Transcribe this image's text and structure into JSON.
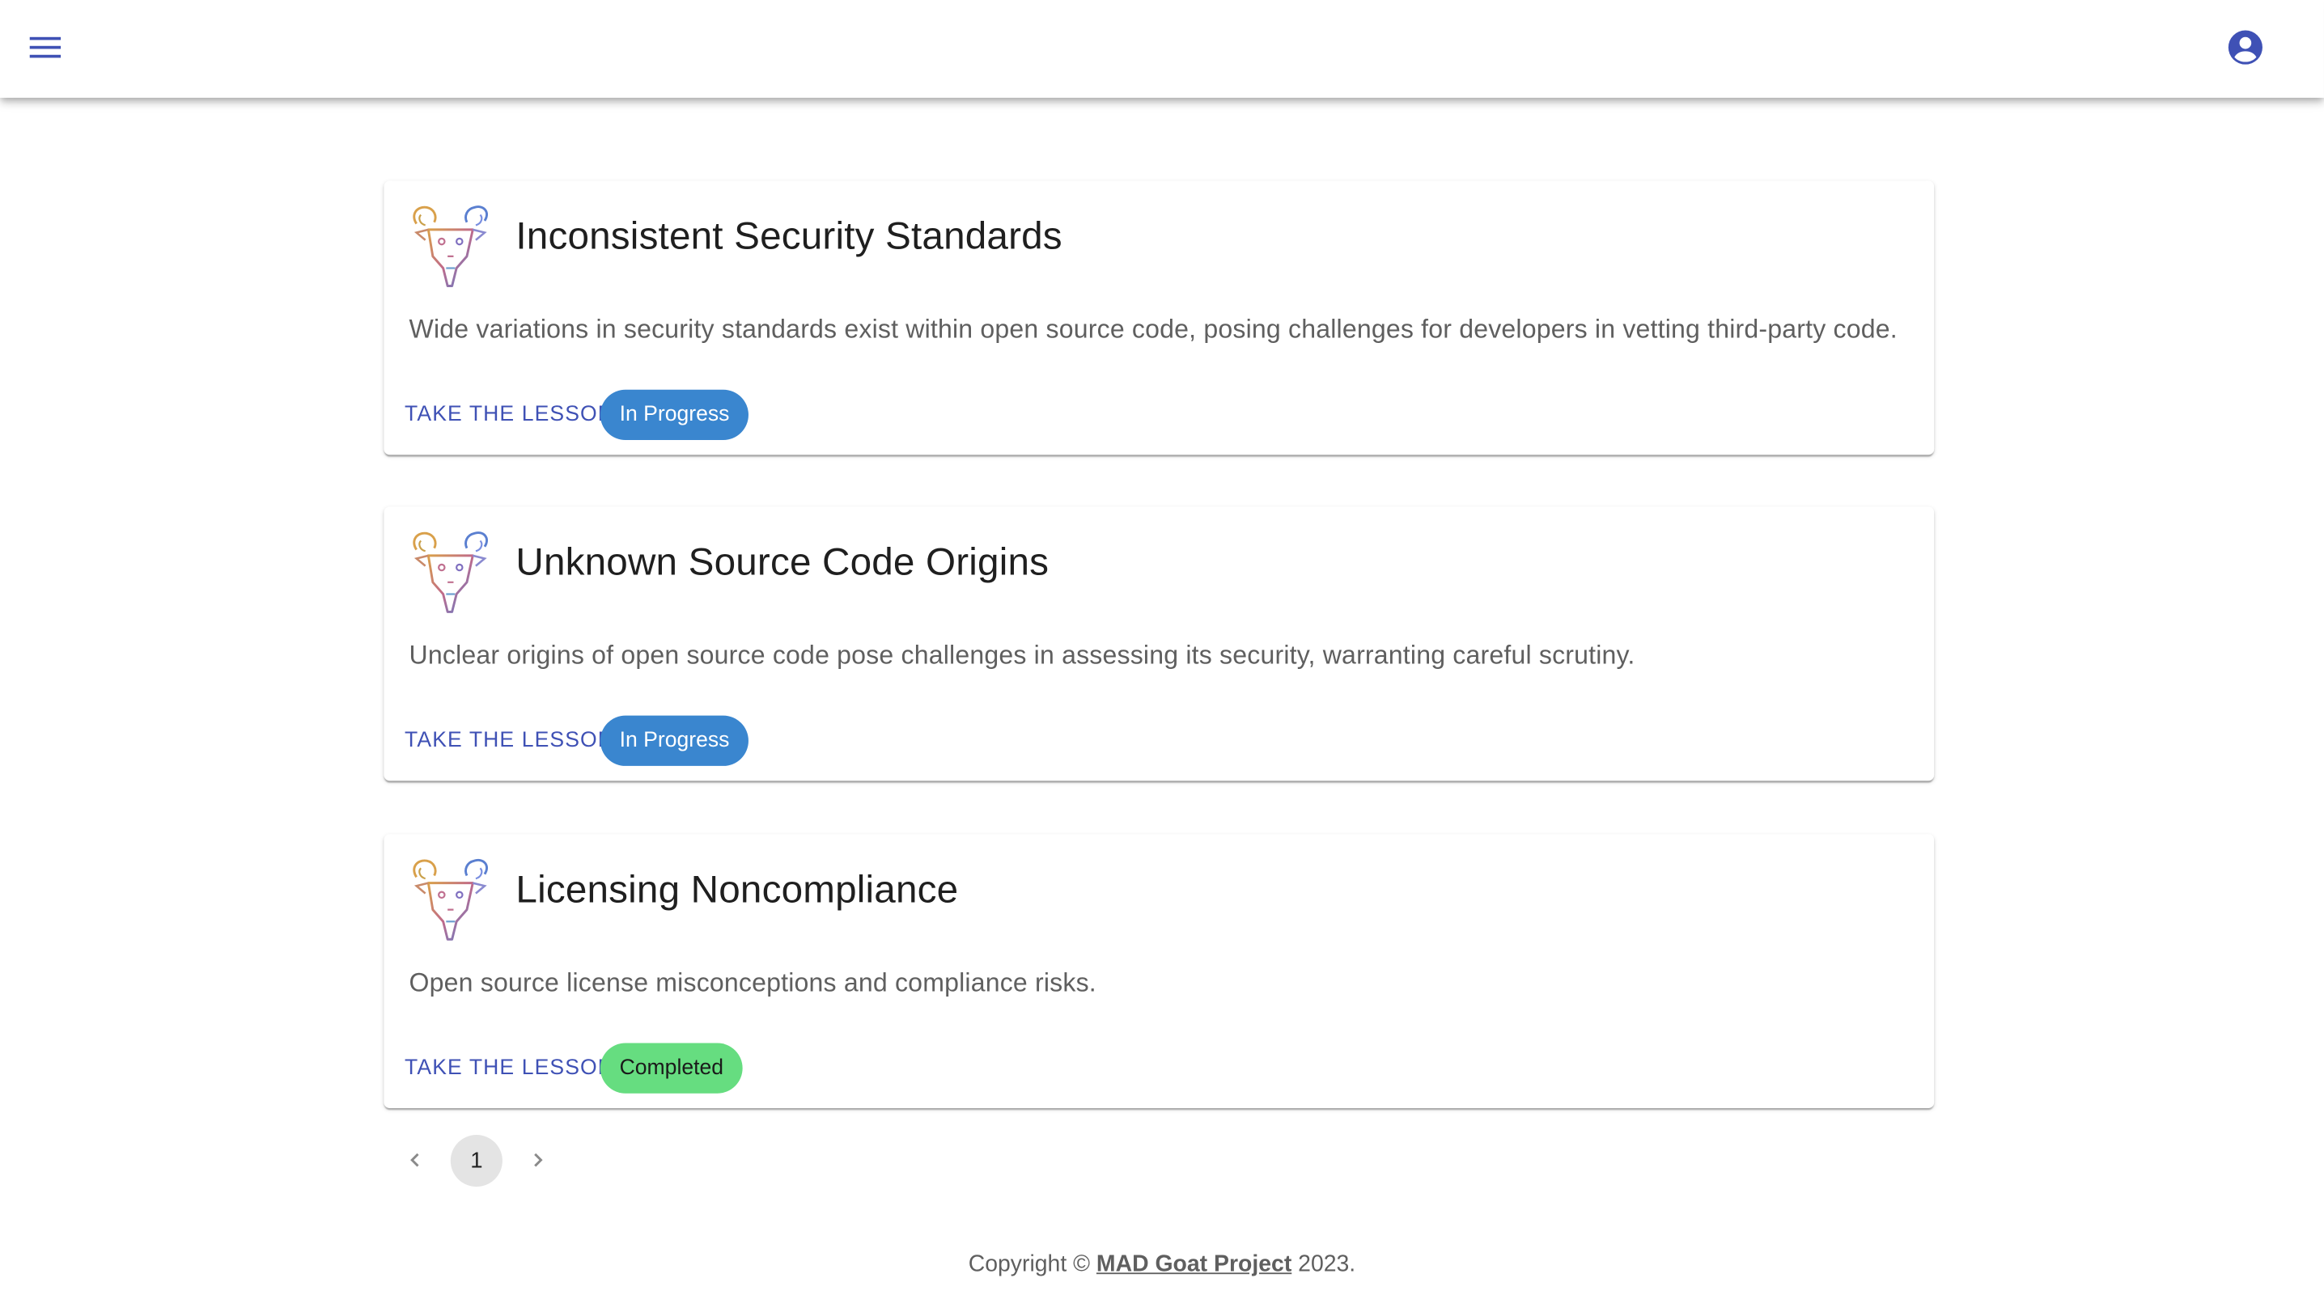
{
  "header": {
    "menu_icon": "menu-icon",
    "account_icon": "account-circle-icon",
    "accent_color": "#3f51b5"
  },
  "lessons": [
    {
      "title": "Inconsistent Security Standards",
      "description": "Wide variations in security standards exist within open source code, posing challenges for developers in vetting third-party code.",
      "action_label": "TAKE THE LESSON",
      "status": "In Progress",
      "status_color": "#3a86cf"
    },
    {
      "title": "Unknown Source Code Origins",
      "description": "Unclear origins of open source code pose challenges in assessing its security, warranting careful scrutiny.",
      "action_label": "TAKE THE LESSON",
      "status": "In Progress",
      "status_color": "#3a86cf"
    },
    {
      "title": "Licensing Noncompliance",
      "description": "Open source license misconceptions and compliance risks.",
      "action_label": "TAKE THE LESSON",
      "status": "Completed",
      "status_color": "#66dd80"
    }
  ],
  "pagination": {
    "current_page": "1",
    "prev_icon": "chevron-left-icon",
    "next_icon": "chevron-right-icon"
  },
  "footer": {
    "prefix": "Copyright © ",
    "link_text": "MAD Goat Project",
    "suffix": " 2023."
  }
}
